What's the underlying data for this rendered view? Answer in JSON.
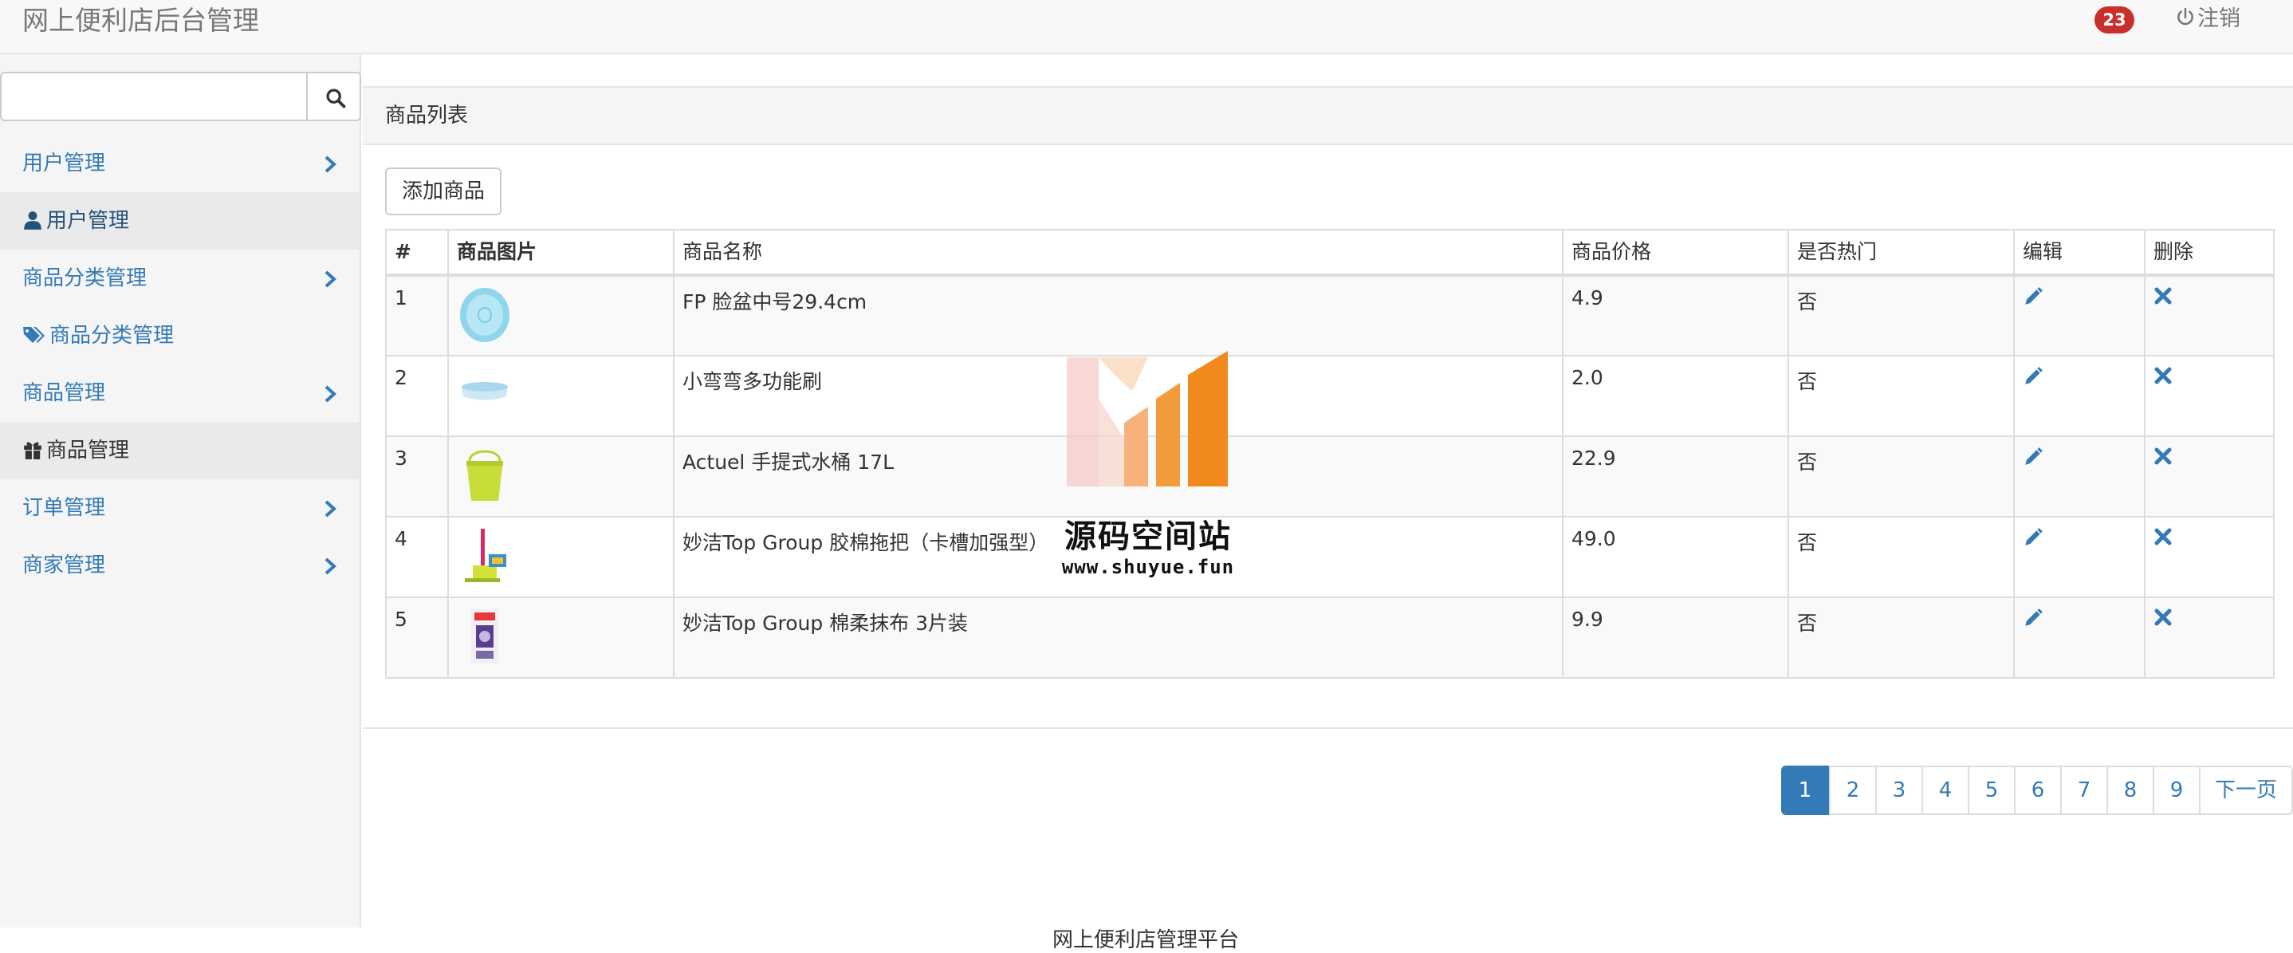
{
  "header": {
    "brand": "网上便利店后台管理",
    "badge_count": "23",
    "logout_label": "注销"
  },
  "sidebar": {
    "search": {
      "placeholder": ""
    },
    "items": [
      {
        "label": "用户管理",
        "type": "group"
      },
      {
        "label": "用户管理",
        "type": "sub",
        "icon": "user-icon"
      },
      {
        "label": "商品分类管理",
        "type": "group"
      },
      {
        "label": "商品分类管理",
        "type": "sub",
        "icon": "tags-icon"
      },
      {
        "label": "商品管理",
        "type": "group"
      },
      {
        "label": "商品管理",
        "type": "sub",
        "icon": "gift-icon"
      },
      {
        "label": "订单管理",
        "type": "group"
      },
      {
        "label": "商家管理",
        "type": "group"
      }
    ]
  },
  "main": {
    "panel_title": "商品列表",
    "add_button": "添加商品",
    "table": {
      "headers": [
        "#",
        "商品图片",
        "商品名称",
        "商品价格",
        "是否热门",
        "编辑",
        "删除"
      ],
      "rows": [
        {
          "num": "1",
          "image": "basin-thumbnail",
          "name": "FP 脸盆中号29.4cm",
          "price": "4.9",
          "hot": "否"
        },
        {
          "num": "2",
          "image": "brush-thumbnail",
          "name": "小弯弯多功能刷",
          "price": "2.0",
          "hot": "否"
        },
        {
          "num": "3",
          "image": "bucket-thumbnail",
          "name": "Actuel 手提式水桶 17L",
          "price": "22.9",
          "hot": "否"
        },
        {
          "num": "4",
          "image": "mop-thumbnail",
          "name": "妙洁Top Group 胶棉拖把（卡槽加强型）",
          "price": "49.0",
          "hot": "否"
        },
        {
          "num": "5",
          "image": "cloth-pack-thumbnail",
          "name": "妙洁Top Group 棉柔抹布 3片装",
          "price": "9.9",
          "hot": "否"
        }
      ]
    },
    "pagination": [
      "1",
      "2",
      "3",
      "4",
      "5",
      "6",
      "7",
      "8",
      "9",
      "下一页"
    ],
    "active_page": "1"
  },
  "watermark": {
    "title": "源码空间站",
    "url": "www.shuyue.fun"
  },
  "footer": {
    "text": "网上便利店管理平台"
  },
  "colors": {
    "link": "#337ab7",
    "badge": "#c9302c",
    "navbar_bg": "#f8f8f8",
    "sidebar_bg": "#f5f5f5"
  }
}
